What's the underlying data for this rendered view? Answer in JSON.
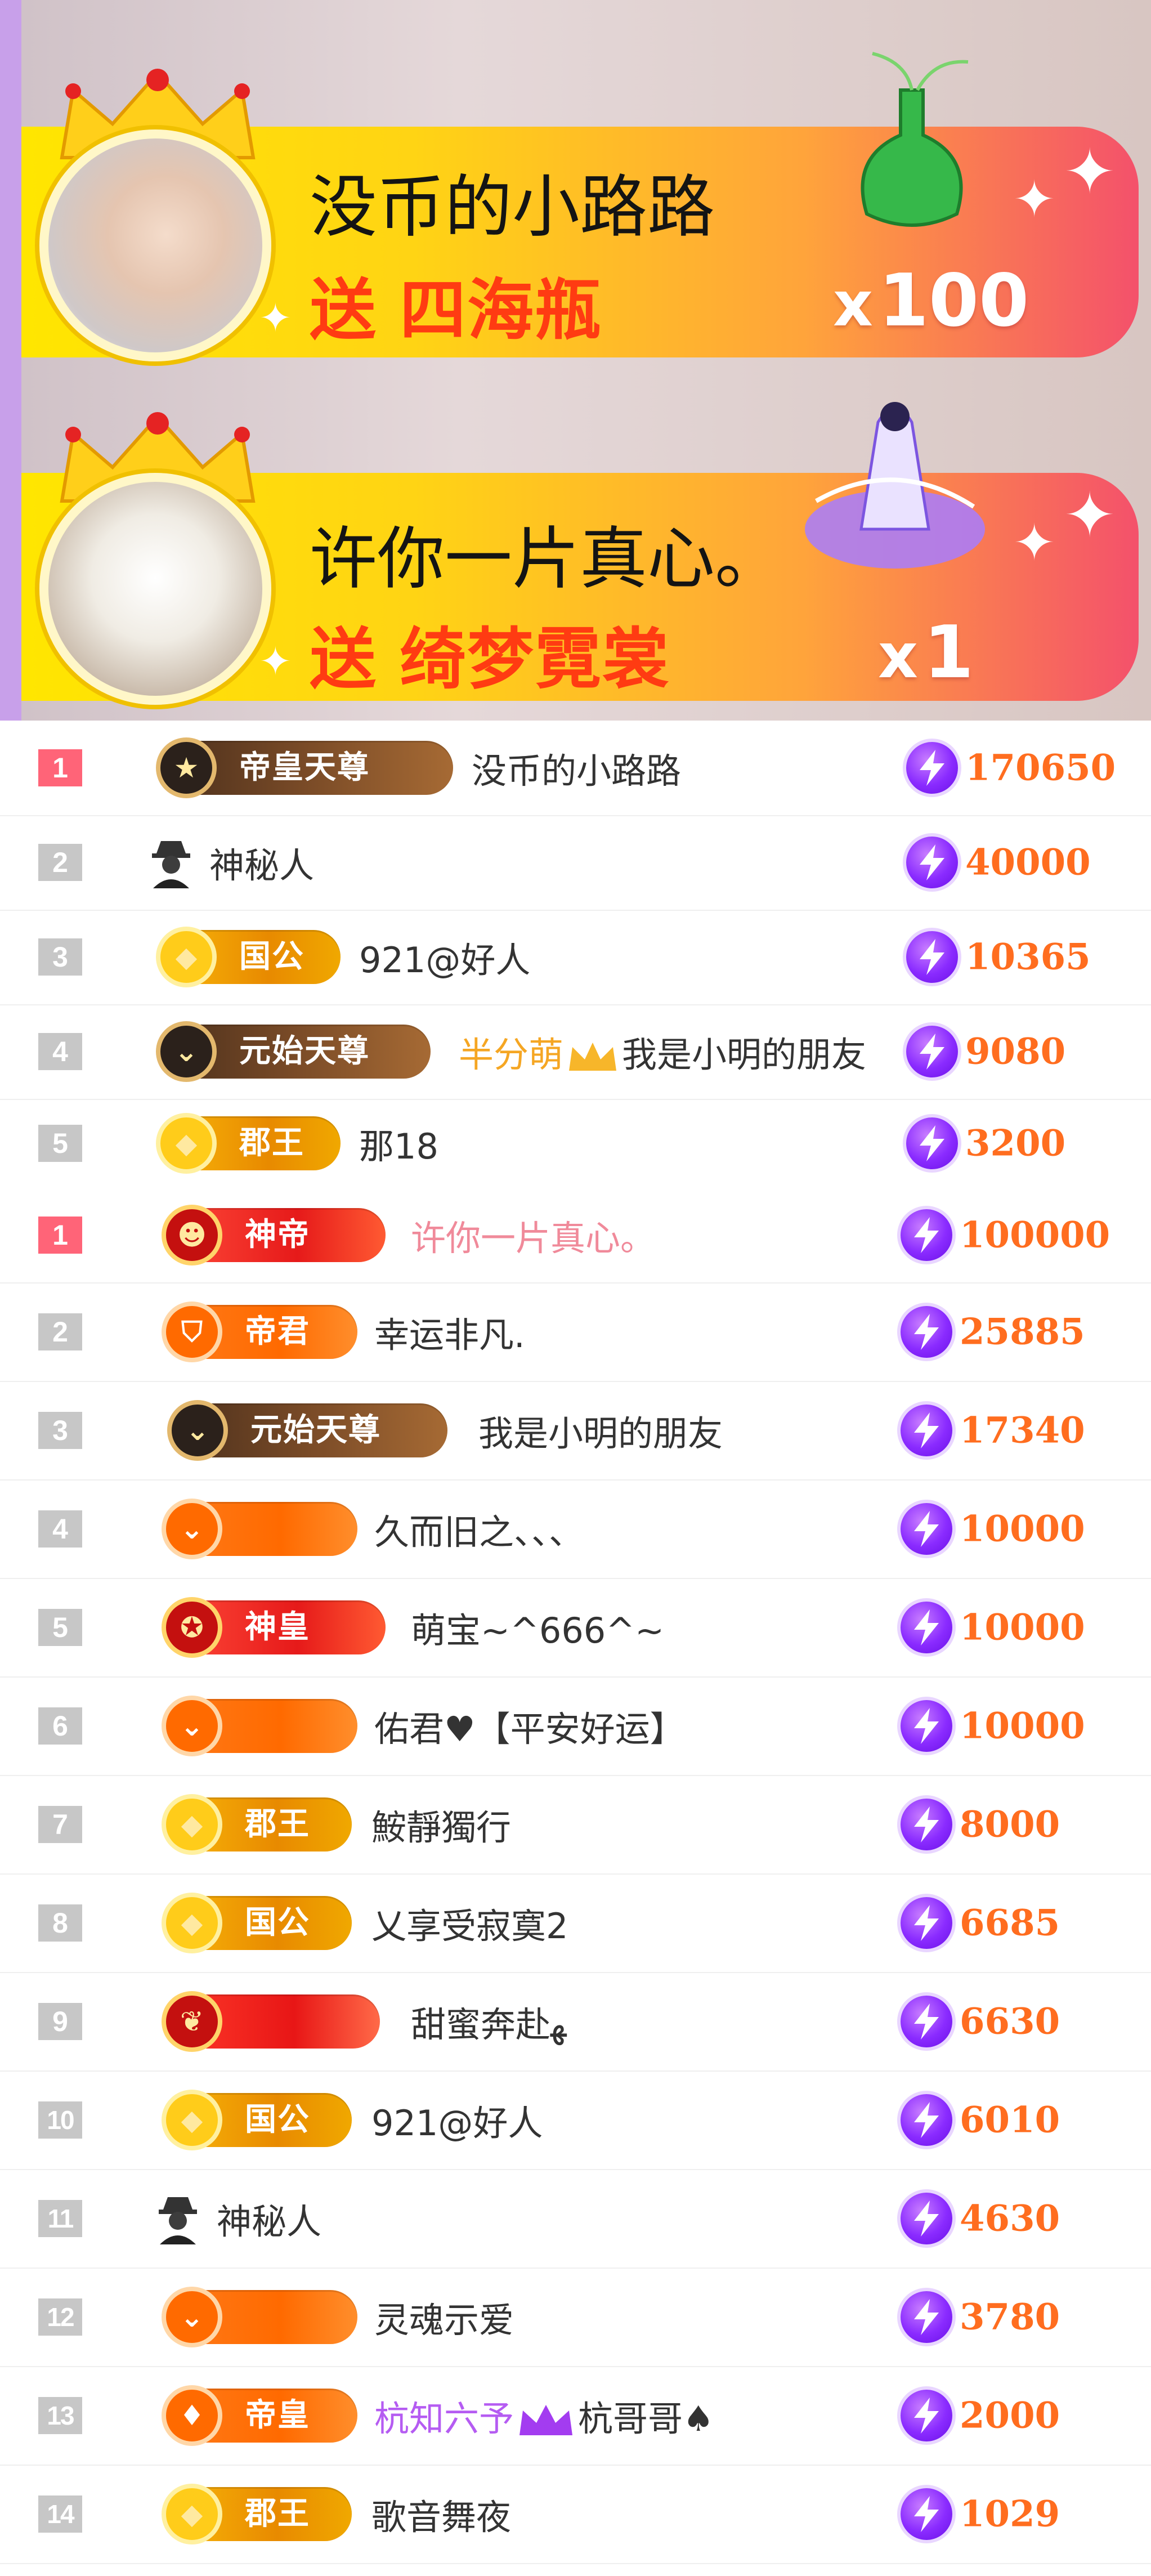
{
  "banners": [
    {
      "sender": "没币的小路路",
      "verb": "送",
      "gift": "四海瓶",
      "count_prefix": "x",
      "count": "100"
    },
    {
      "sender": "许你一片真心。",
      "verb": "送",
      "gift": "绮梦霓裳",
      "count_prefix": "x",
      "count": "1"
    }
  ],
  "ranking_list_1": [
    {
      "rank": "1",
      "badge": "帝皇天尊",
      "name": "没币的小路路",
      "score": "170650"
    },
    {
      "rank": "2",
      "badge": "",
      "name": "神秘人",
      "score": "40000"
    },
    {
      "rank": "3",
      "badge": "国公",
      "name": "921@好人",
      "score": "10365"
    },
    {
      "rank": "4",
      "badge": "元始天尊",
      "name_fan": "半分萌",
      "name": "我是小明的朋友",
      "score": "9080"
    },
    {
      "rank": "5",
      "badge": "郡王",
      "name": "那18",
      "score": "3200"
    }
  ],
  "ranking_list_2": [
    {
      "rank": "1",
      "badge": "神帝",
      "name": "许你一片真心。",
      "score": "100000"
    },
    {
      "rank": "2",
      "badge": "帝君",
      "name": "幸运非凡.",
      "score": "25885"
    },
    {
      "rank": "3",
      "badge": "元始天尊",
      "name": "我是小明的朋友",
      "score": "17340"
    },
    {
      "rank": "4",
      "badge": "",
      "name": "久而旧之、、、",
      "score": "10000"
    },
    {
      "rank": "5",
      "badge": "神皇",
      "name": "萌宝~^666^~",
      "score": "10000"
    },
    {
      "rank": "6",
      "badge": "",
      "name": "佑君♥【平安好运】",
      "score": "10000"
    },
    {
      "rank": "7",
      "badge": "郡王",
      "name": "鮟靜獨行",
      "score": "8000"
    },
    {
      "rank": "8",
      "badge": "国公",
      "name": "乂享受寂寞2",
      "score": "6685"
    },
    {
      "rank": "9",
      "badge": "",
      "name": "甜蜜奔赴ﻬ",
      "score": "6630"
    },
    {
      "rank": "10",
      "badge": "国公",
      "name": "921@好人",
      "score": "6010"
    },
    {
      "rank": "11",
      "badge": "",
      "name": "神秘人",
      "score": "4630"
    },
    {
      "rank": "12",
      "badge": "",
      "name": "灵魂示爱",
      "score": "3780"
    },
    {
      "rank": "13",
      "badge": "帝皇",
      "name_fan": "杭知六予",
      "name": "杭哥哥♠",
      "score": "2000"
    },
    {
      "rank": "14",
      "badge": "郡王",
      "name": "歌音舞夜",
      "score": "1029"
    }
  ],
  "colors": {
    "score": "#ff6d1f",
    "rank_first": "#ff6478",
    "rank_default": "#c7c7c7",
    "banner_gift": "#ff3b12"
  },
  "icons": [
    "crown-icon",
    "vase-icon",
    "fairy-icon",
    "sparkle-icon",
    "mystery-user-icon",
    "lightning-currency-icon",
    "crown-mini-icon",
    "spade-icon"
  ]
}
